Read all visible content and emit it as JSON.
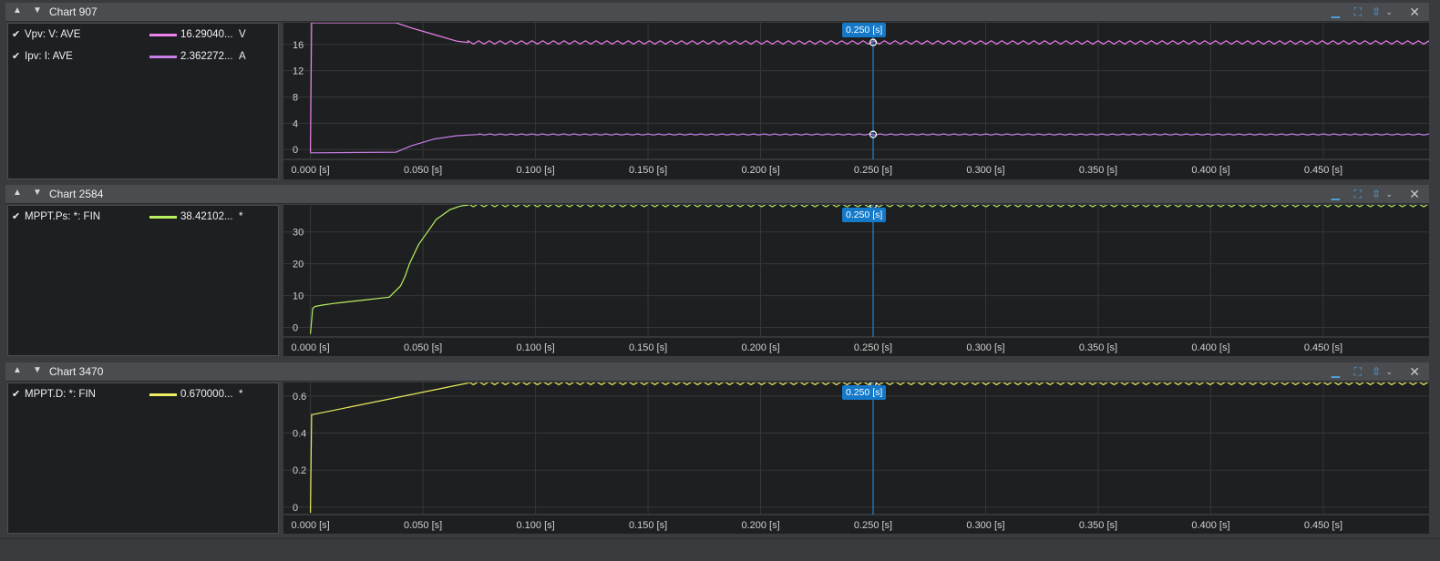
{
  "cursor": {
    "label": "0.250 [s]",
    "x": 0.25,
    "color": "#1a86d8"
  },
  "colors": {
    "background": "#1e1f21",
    "grid": "#35373a",
    "tick_text": "#d0d0d0"
  },
  "panels": [
    {
      "title": "Chart 907",
      "legend": [
        {
          "name": "Vpv: V: AVE",
          "value": "16.29040...",
          "unit": "V",
          "color": "#ee82ee"
        },
        {
          "name": "Ipv: I: AVE",
          "value": "2.362272...",
          "unit": "A",
          "color": "#c77ee6"
        }
      ],
      "icons": [
        "minimize-icon",
        "fit-icon",
        "vertical-fit-icon",
        "chevron-down-icon",
        "close-icon"
      ]
    },
    {
      "title": "Chart 2584",
      "legend": [
        {
          "name": "MPPT.Ps: *: FIN",
          "value": "38.42102...",
          "unit": "*",
          "color": "#b8f060"
        }
      ],
      "icons": [
        "minimize-icon",
        "fit-icon",
        "vertical-fit-icon",
        "chevron-down-icon",
        "close-icon"
      ]
    },
    {
      "title": "Chart 3470",
      "legend": [
        {
          "name": "MPPT.D: *: FIN",
          "value": "0.670000...",
          "unit": "*",
          "color": "#eef060"
        }
      ],
      "icons": [
        "minimize-icon",
        "fit-icon",
        "vertical-fit-icon",
        "chevron-down-icon",
        "close-icon"
      ]
    }
  ],
  "chart_data": [
    {
      "type": "line",
      "title": "Chart 907",
      "x_ticks": [
        "0.000 [s]",
        "0.050 [s]",
        "0.100 [s]",
        "0.150 [s]",
        "0.200 [s]",
        "0.250 [s]",
        "0.300 [s]",
        "0.350 [s]",
        "0.400 [s]",
        "0.450 [s]"
      ],
      "y_ticks": [
        "0",
        "4",
        "8",
        "12",
        "16"
      ],
      "xlim": [
        -0.012,
        0.497
      ],
      "ylim": [
        -1.5,
        19.3
      ],
      "grid": true,
      "series": [
        {
          "name": "Vpv: V: AVE",
          "color": "#ee82ee",
          "x": [
            0,
            0.0005,
            0.038,
            0.045,
            0.055,
            0.065,
            0.07,
            0.497
          ],
          "y": [
            -0.5,
            19.3,
            19.3,
            18.5,
            17.5,
            16.5,
            16.3,
            16.3
          ]
        },
        {
          "name": "Ipv: I: AVE",
          "color": "#c77ee6",
          "x": [
            0,
            0.0005,
            0.038,
            0.045,
            0.055,
            0.065,
            0.075,
            0.497
          ],
          "y": [
            -0.5,
            -0.5,
            -0.4,
            0.6,
            1.6,
            2.1,
            2.3,
            2.3
          ]
        }
      ],
      "markers": [
        {
          "x": 0.25,
          "y": 16.3
        },
        {
          "x": 0.25,
          "y": 2.3
        }
      ]
    },
    {
      "type": "line",
      "title": "Chart 2584",
      "x_ticks": [
        "0.000 [s]",
        "0.050 [s]",
        "0.100 [s]",
        "0.150 [s]",
        "0.200 [s]",
        "0.250 [s]",
        "0.300 [s]",
        "0.350 [s]",
        "0.400 [s]",
        "0.450 [s]"
      ],
      "y_ticks": [
        "0",
        "10",
        "20",
        "30"
      ],
      "xlim": [
        -0.012,
        0.497
      ],
      "ylim": [
        -3,
        38.5
      ],
      "grid": true,
      "series": [
        {
          "name": "MPPT.Ps: *: FIN",
          "color": "#b8f060",
          "x": [
            0,
            0.001,
            0.002,
            0.005,
            0.01,
            0.015,
            0.02,
            0.025,
            0.03,
            0.035,
            0.04,
            0.042,
            0.044,
            0.046,
            0.048,
            0.05,
            0.052,
            0.054,
            0.056,
            0.058,
            0.06,
            0.062,
            0.064,
            0.066,
            0.068,
            0.07,
            0.497
          ],
          "y": [
            -2,
            6,
            6.6,
            7.0,
            7.5,
            7.9,
            8.3,
            8.7,
            9.1,
            9.5,
            13,
            16,
            20,
            23,
            26,
            28,
            30,
            32,
            34,
            35,
            36,
            37,
            37.5,
            38,
            38.3,
            38.4,
            38.4
          ]
        }
      ],
      "markers": [
        {
          "x": 0.25,
          "y": 38.4
        }
      ]
    },
    {
      "type": "line",
      "title": "Chart 3470",
      "x_ticks": [
        "0.000 [s]",
        "0.050 [s]",
        "0.100 [s]",
        "0.150 [s]",
        "0.200 [s]",
        "0.250 [s]",
        "0.300 [s]",
        "0.350 [s]",
        "0.400 [s]",
        "0.450 [s]"
      ],
      "y_ticks": [
        "0",
        "0.2",
        "0.4",
        "0.6"
      ],
      "xlim": [
        -0.012,
        0.497
      ],
      "ylim": [
        -0.04,
        0.673
      ],
      "grid": true,
      "series": [
        {
          "name": "MPPT.D: *: FIN",
          "color": "#eef060",
          "x": [
            0,
            0.0005,
            0.001,
            0.07,
            0.497
          ],
          "y": [
            -0.03,
            0.5,
            0.5,
            0.67,
            0.67
          ]
        }
      ],
      "markers": [
        {
          "x": 0.25,
          "y": 0.67
        }
      ]
    }
  ]
}
